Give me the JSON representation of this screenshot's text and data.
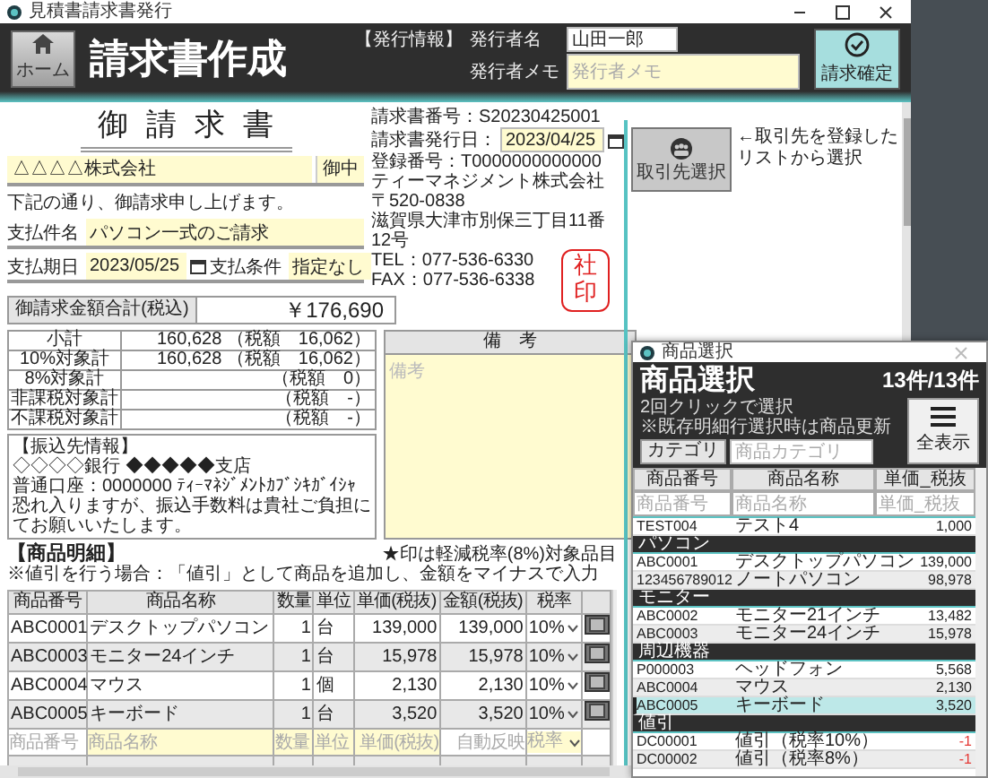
{
  "main_window": {
    "title": "見積書請求書発行"
  },
  "header": {
    "home_button": "ホーム",
    "title": "請求書作成",
    "section_label": "【発行情報】",
    "issuer_name_label": "発行者名",
    "issuer_name": "山田一郎",
    "issuer_memo_label": "発行者メモ",
    "issuer_memo_placeholder": "発行者メモ",
    "confirm_button": "請求確定"
  },
  "document": {
    "heading": "御請求書",
    "customer": "△△△△株式会社",
    "honorific": "御中",
    "greeting": "下記の通り、御請求申し上げます。",
    "subject_label": "支払件名",
    "subject": "パソコン一式のご請求",
    "due_date_label": "支払期日",
    "due_date": "2023/05/25",
    "terms_label": "支払条件",
    "terms": "指定なし"
  },
  "issuer_info": {
    "invoice_number": "請求書番号：S20230425001",
    "issue_date_label": "請求書発行日：",
    "issue_date": "2023/04/25",
    "lines": [
      "登録番号：T0000000000000",
      "ティーマネジメント株式会社",
      "〒520-0838",
      "滋賀県大津市別保三丁目11番12号",
      "TEL：077-536-6330",
      "FAX：077-536-6338"
    ],
    "stamp": "社印"
  },
  "partner": {
    "button": "取引先選択",
    "hint": [
      "←取引先を登録した",
      "リストから選択"
    ]
  },
  "total": {
    "label": "御請求金額合計(税込)",
    "value": "￥176,690"
  },
  "summary": [
    {
      "label": "小計",
      "amount": "160,628",
      "tax": "（税額　16,062）"
    },
    {
      "label": "10%対象計",
      "amount": "160,628",
      "tax": "（税額　16,062）"
    },
    {
      "label": "8%対象計",
      "tax": "（税額　0）"
    },
    {
      "label": "非課税対象計",
      "tax": "（税額　-）"
    },
    {
      "label": "不課税対象計",
      "tax": "（税額　-）"
    }
  ],
  "bank": {
    "lines": [
      "【振込先情報】",
      "◇◇◇◇銀行 ◆◆◆◆◆支店",
      "普通口座：0000000 ﾃｨｰﾏﾈｼﾞﾒﾝﾄｶﾌﾞｼｷｶﾞｲｼｬ",
      "恐れ入りますが、振込手数料は貴社ご負担にてお願いいたします。"
    ]
  },
  "remarks": {
    "header": "備　考",
    "placeholder": "備考"
  },
  "items": {
    "title": "【商品明細】",
    "note": "※値引を行う場合：「値引」として商品を追加し、金額をマイナスで入力",
    "legend": "★印は軽減税率(8%)対象品目",
    "columns": [
      "商品番号",
      "商品名称",
      "数量",
      "単位",
      "単価(税抜)",
      "金額(税抜)",
      "税率"
    ],
    "rows": [
      {
        "code": "ABC0001",
        "name": "デスクトップパソコン",
        "qty": "1",
        "unit": "台",
        "price": "139,000",
        "amount": "139,000",
        "tax_rate": "10%"
      },
      {
        "code": "ABC0003",
        "name": "モニター24インチ",
        "qty": "1",
        "unit": "台",
        "price": "15,978",
        "amount": "15,978",
        "tax_rate": "10%"
      },
      {
        "code": "ABC0004",
        "name": "マウス",
        "qty": "1",
        "unit": "個",
        "price": "2,130",
        "amount": "2,130",
        "tax_rate": "10%"
      },
      {
        "code": "ABC0005",
        "name": "キーボード",
        "qty": "1",
        "unit": "台",
        "price": "3,520",
        "amount": "3,520",
        "tax_rate": "10%"
      }
    ],
    "new_row": [
      {
        "placeholder": "商品番号"
      },
      {
        "placeholder": "商品名称"
      },
      {
        "placeholder": "数量"
      },
      {
        "placeholder": "単位"
      },
      {
        "placeholder": "単価(税抜)"
      },
      {
        "placeholder": "自動反映"
      },
      {
        "placeholder": "税率"
      }
    ]
  },
  "product_picker": {
    "title": "商品選択",
    "heading": "商品選択",
    "notes": [
      "2回クリックで選択",
      "※既存明細行選択時は商品更新"
    ],
    "count": "13件/13件",
    "show_all_button": "全表示",
    "category_label": "カテゴリ",
    "category_placeholder": "商品カテゴリ",
    "columns": [
      "商品番号",
      "商品名称",
      "単価_税抜"
    ],
    "filter_placeholders": [
      "商品番号",
      "商品名称",
      "単価_税抜"
    ],
    "list": [
      {
        "kind": "item",
        "code": "TEST004",
        "name": "テスト4",
        "price": "1,000",
        "color": "#222222",
        "selected": false
      },
      {
        "kind": "group",
        "label": "パソコン"
      },
      {
        "kind": "item",
        "code": "ABC0001",
        "name": "デスクトップパソコン",
        "price": "139,000",
        "color": "#222222",
        "selected": false
      },
      {
        "kind": "item",
        "code": "123456789012",
        "name": "ノートパソコン",
        "price": "98,978",
        "color": "#222222",
        "selected": false
      },
      {
        "kind": "group",
        "label": "モニター"
      },
      {
        "kind": "item",
        "code": "ABC0002",
        "name": "モニター21インチ",
        "price": "13,482",
        "color": "#222222",
        "selected": false
      },
      {
        "kind": "item",
        "code": "ABC0003",
        "name": "モニター24インチ",
        "price": "15,978",
        "color": "#222222",
        "selected": false
      },
      {
        "kind": "group",
        "label": "周辺機器"
      },
      {
        "kind": "item",
        "code": "P000003",
        "name": "ヘッドフォン",
        "price": "5,568",
        "color": "#222222",
        "selected": false
      },
      {
        "kind": "item",
        "code": "ABC0004",
        "name": "マウス",
        "price": "2,130",
        "color": "#222222",
        "selected": false
      },
      {
        "kind": "item",
        "code": "ABC0005",
        "name": "キーボード",
        "price": "3,520",
        "color": "#222222",
        "selected": true
      },
      {
        "kind": "group",
        "label": "値引"
      },
      {
        "kind": "item",
        "code": "DC00001",
        "name": "値引（税率10%）",
        "price": "-1",
        "color": "#e53935",
        "selected": false
      },
      {
        "kind": "item",
        "code": "DC00002",
        "name": "値引（税率8%）",
        "price": "-1",
        "color": "#e53935",
        "selected": false
      }
    ]
  }
}
